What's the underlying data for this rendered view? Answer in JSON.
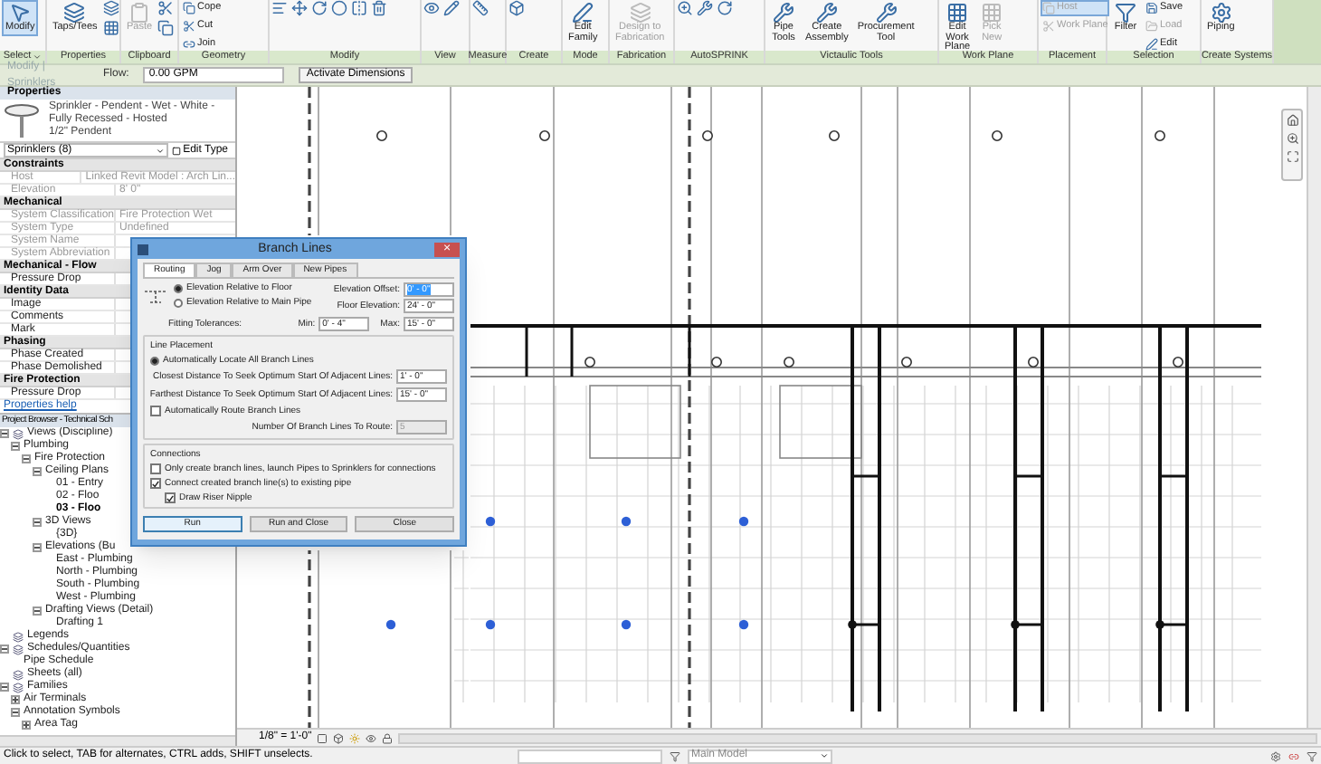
{
  "ribbon": {
    "panels": [
      {
        "label": "Select",
        "dropdown": true,
        "buttons": [
          {
            "label": "Modify",
            "kind": "large",
            "selected": true,
            "disabled": false
          }
        ]
      },
      {
        "label": "Properties",
        "buttons": [
          {
            "label": "Taps/Tees",
            "kind": "large",
            "selected": false,
            "disabled": false
          }
        ]
      },
      {
        "label": "Clipboard",
        "buttons": [
          {
            "label": "Paste",
            "kind": "large",
            "selected": false,
            "disabled": true
          }
        ]
      },
      {
        "label": "Geometry",
        "buttons": [
          {
            "label": "Cope",
            "kind": "small",
            "selected": false,
            "disabled": false
          },
          {
            "label": "Cut",
            "kind": "small",
            "selected": false,
            "disabled": false
          },
          {
            "label": "Join",
            "kind": "small",
            "selected": false,
            "disabled": false
          }
        ]
      },
      {
        "label": "Modify"
      },
      {
        "label": "View"
      },
      {
        "label": "Measure"
      },
      {
        "label": "Create"
      },
      {
        "label": "Mode",
        "buttons": [
          {
            "label": "Edit Family",
            "kind": "large",
            "selected": false,
            "disabled": false
          }
        ]
      },
      {
        "label": "Fabrication",
        "buttons": [
          {
            "label": "Design to Fabrication",
            "kind": "large",
            "selected": false,
            "disabled": true
          }
        ]
      },
      {
        "label": "AutoSPRINK"
      },
      {
        "label": "Victaulic Tools",
        "buttons": [
          {
            "label": "Pipe Tools",
            "kind": "large",
            "selected": false,
            "disabled": false
          },
          {
            "label": "Create Assembly",
            "kind": "large",
            "selected": false,
            "disabled": false
          },
          {
            "label": "Procurement Tool",
            "kind": "large",
            "selected": false,
            "disabled": false
          }
        ]
      },
      {
        "label": "Work Plane",
        "buttons": [
          {
            "label": "Edit Work Plane",
            "kind": "large",
            "selected": false,
            "disabled": false
          },
          {
            "label": "Pick New",
            "kind": "large",
            "selected": false,
            "disabled": true
          }
        ]
      },
      {
        "label": "Placement",
        "buttons": [
          {
            "label": "Host",
            "kind": "small",
            "selected": true,
            "disabled": true
          },
          {
            "label": "Work Plane",
            "kind": "small",
            "selected": false,
            "disabled": true
          }
        ]
      },
      {
        "label": "Selection",
        "buttons": [
          {
            "label": "Filter",
            "kind": "large",
            "selected": false,
            "disabled": false
          },
          {
            "label": "Save",
            "kind": "small",
            "selected": false,
            "disabled": false
          },
          {
            "label": "Load",
            "kind": "small",
            "selected": false,
            "disabled": true
          },
          {
            "label": "Edit",
            "kind": "small",
            "selected": false,
            "disabled": false
          }
        ]
      },
      {
        "label": "Create Systems",
        "buttons": [
          {
            "label": "Piping",
            "kind": "large",
            "selected": false,
            "disabled": false
          }
        ]
      }
    ]
  },
  "options_bar": {
    "context": "Modify | Sprinklers",
    "flow_label": "Flow:",
    "flow_value": "0.00 GPM",
    "activate_button": "Activate Dimensions"
  },
  "properties": {
    "title": "Properties",
    "family": "Sprinkler - Pendent - Wet - White - Fully Recessed - Hosted",
    "type": "1/2\" Pendent",
    "selector": "Sprinklers (8)",
    "edit_type": "Edit Type",
    "groups": [
      {
        "name": "Constraints",
        "rows": [
          {
            "label": "Host",
            "value": "Linked Revit Model : Arch Lin...",
            "disabled": true
          },
          {
            "label": "Elevation",
            "value": "8' 0\"",
            "disabled": true
          }
        ]
      },
      {
        "name": "Mechanical",
        "rows": [
          {
            "label": "System Classification",
            "value": "Fire Protection Wet",
            "disabled": true
          },
          {
            "label": "System Type",
            "value": "Undefined",
            "disabled": true
          },
          {
            "label": "System Name",
            "disabled": true
          },
          {
            "label": "System Abbreviation",
            "disabled": true
          }
        ]
      },
      {
        "name": "Mechanical - Flow",
        "rows": [
          {
            "label": "Pressure Drop",
            "disabled": false
          }
        ]
      },
      {
        "name": "Identity Data",
        "rows": [
          {
            "label": "Image",
            "disabled": false
          },
          {
            "label": "Comments",
            "disabled": false
          },
          {
            "label": "Mark",
            "disabled": false
          }
        ]
      },
      {
        "name": "Phasing",
        "rows": [
          {
            "label": "Phase Created",
            "disabled": false
          },
          {
            "label": "Phase Demolished",
            "disabled": false
          }
        ]
      },
      {
        "name": "Fire Protection",
        "rows": [
          {
            "label": "Pressure Drop",
            "disabled": false
          }
        ]
      }
    ],
    "help_link": "Properties help"
  },
  "project_browser": {
    "title": "Project Browser - Technical Sch",
    "tree": [
      {
        "label": "Views (Discipline)",
        "selected": false,
        "expanded": true,
        "children": [
          {
            "label": "Plumbing",
            "selected": false,
            "expanded": true,
            "children": [
              {
                "label": "Fire Protection",
                "selected": false,
                "expanded": true,
                "children": [
                  {
                    "label": "Ceiling Plans",
                    "selected": false,
                    "expanded": true,
                    "children": [
                      {
                        "label": "01 - Entry",
                        "selected": false
                      },
                      {
                        "label": "02 - Floo",
                        "selected": false
                      },
                      {
                        "label": "03 - Floo",
                        "selected": true
                      }
                    ]
                  },
                  {
                    "label": "3D Views",
                    "selected": false,
                    "expanded": true,
                    "children": [
                      {
                        "label": "{3D}",
                        "selected": false
                      }
                    ]
                  },
                  {
                    "label": "Elevations (Bu",
                    "selected": false,
                    "expanded": true,
                    "children": [
                      {
                        "label": "East - Plumbing",
                        "selected": false
                      },
                      {
                        "label": "North - Plumbing",
                        "selected": false
                      },
                      {
                        "label": "South - Plumbing",
                        "selected": false
                      },
                      {
                        "label": "West - Plumbing",
                        "selected": false
                      }
                    ]
                  },
                  {
                    "label": "Drafting Views (Detail)",
                    "selected": false,
                    "expanded": true,
                    "children": [
                      {
                        "label": "Drafting 1",
                        "selected": false
                      }
                    ]
                  }
                ]
              }
            ]
          }
        ]
      },
      {
        "label": "Legends",
        "selected": false
      },
      {
        "label": "Schedules/Quantities",
        "selected": false,
        "expanded": true,
        "children": [
          {
            "label": "Pipe Schedule",
            "selected": false
          }
        ]
      },
      {
        "label": "Sheets (all)",
        "selected": false
      },
      {
        "label": "Families",
        "selected": false,
        "expanded": true,
        "children": [
          {
            "label": "Air Terminals",
            "selected": false,
            "expanded": false
          },
          {
            "label": "Annotation Symbols",
            "selected": false,
            "expanded": true,
            "children": [
              {
                "label": "Area Tag",
                "selected": false,
                "expanded": false
              }
            ]
          }
        ]
      }
    ]
  },
  "dialog": {
    "title": "Branch Lines",
    "close": "×",
    "tabs": [
      {
        "label": "Routing",
        "selected": true
      },
      {
        "label": "Jog",
        "selected": false
      },
      {
        "label": "Arm Over",
        "selected": false
      },
      {
        "label": "New Pipes",
        "selected": false
      }
    ],
    "elevation_modes": [
      {
        "label": "Elevation Relative to Floor",
        "selected": true
      },
      {
        "label": "Elevation Relative to Main Pipe",
        "selected": false
      }
    ],
    "elevation_offset": {
      "label": "Elevation Offset:",
      "value": "0' - 0\""
    },
    "floor_elevation": {
      "label": "Floor Elevation:",
      "value": "24' - 0\""
    },
    "fitting_tolerances": {
      "label": "Fitting Tolerances:",
      "min_label": "Min:",
      "min": "0' - 4\"",
      "max_label": "Max:",
      "max": "15' - 0\""
    },
    "line_placement": {
      "title": "Line Placement",
      "auto_locate": {
        "label": "Automatically Locate All Branch Lines",
        "selected": true
      },
      "closest": {
        "label": "Closest Distance To Seek Optimum Start Of Adjacent Lines:",
        "value": "1' - 0\""
      },
      "farthest": {
        "label": "Farthest Distance To Seek Optimum Start Of Adjacent Lines:",
        "value": "15' - 0\""
      },
      "auto_route": {
        "label": "Automatically Route Branch Lines",
        "checked": false
      },
      "count": {
        "label": "Number Of Branch Lines To Route:",
        "value": "5",
        "disabled": true
      }
    },
    "connections": {
      "title": "Connections",
      "options": [
        {
          "label": "Only create branch lines, launch Pipes to Sprinklers for connections",
          "checked": false
        },
        {
          "label": "Connect created branch line(s) to existing pipe",
          "checked": true
        },
        {
          "label": "Draw Riser Nipple",
          "checked": true
        }
      ]
    },
    "buttons": [
      "Run",
      "Run and Close",
      "Close"
    ]
  },
  "view_bar": {
    "scale": "1/8\" = 1'-0\""
  },
  "status_bar": {
    "message": "Click to select, TAB for alternates, CTRL adds, SHIFT unselects.",
    "model": "Main Model"
  }
}
